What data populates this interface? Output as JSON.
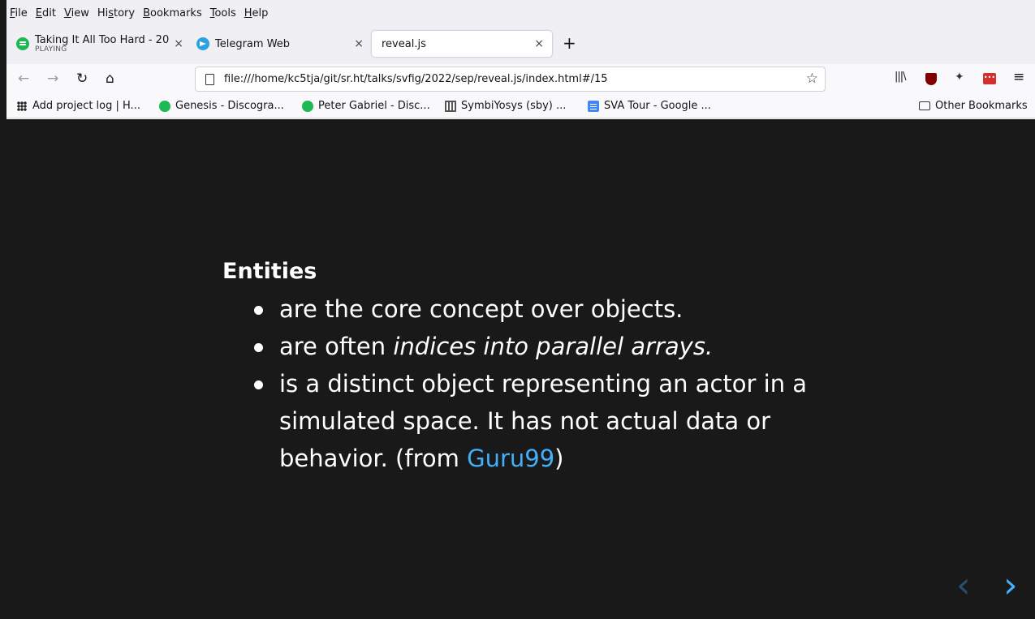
{
  "menu": [
    "File",
    "Edit",
    "View",
    "History",
    "Bookmarks",
    "Tools",
    "Help"
  ],
  "menu_underline": [
    "F",
    "E",
    "V",
    "s",
    "B",
    "T",
    "H"
  ],
  "tabs": [
    {
      "title": "Taking It All Too Hard - 20",
      "subtitle": "PLAYING",
      "favicon": "spotify-icon"
    },
    {
      "title": "Telegram Web",
      "favicon": "telegram-icon"
    },
    {
      "title": "reveal.js",
      "favicon": ""
    }
  ],
  "url": "file:///home/kc5tja/git/sr.ht/talks/svfig/2022/sep/reveal.js/index.html#/15",
  "bookmarks": [
    {
      "label": "Add project log | H...",
      "icon": "hackaday-icon"
    },
    {
      "label": "Genesis - Discogra...",
      "icon": "spotify-icon"
    },
    {
      "label": "Peter Gabriel - Disc...",
      "icon": "spotify-icon"
    },
    {
      "label": "SymbiYosys (sby) ...",
      "icon": "sby-icon"
    },
    {
      "label": "SVA Tour - Google ...",
      "icon": "google-docs-icon"
    }
  ],
  "other_bookmarks": "Other Bookmarks",
  "slide": {
    "heading": "Entities",
    "bullets": [
      {
        "text": "are the core concept over objects."
      },
      {
        "prefix": "are often ",
        "emphasis": "indices into parallel arrays."
      },
      {
        "text": "is a distinct object representing an actor in a simulated space. It has not actual data or behavior. (from ",
        "link": "Guru99",
        "suffix": ")"
      }
    ]
  },
  "colors": {
    "slide_background": "#191919",
    "link": "#42affa",
    "spotify": "#1db954",
    "telegram": "#2aa3e0"
  },
  "icons": {
    "back": "←",
    "forward": "→",
    "reload": "↻",
    "home": "⌂",
    "star": "☆",
    "close": "×",
    "new_tab": "+",
    "library": "|||\\",
    "menu": "≡",
    "prev": "‹",
    "next": "›"
  }
}
